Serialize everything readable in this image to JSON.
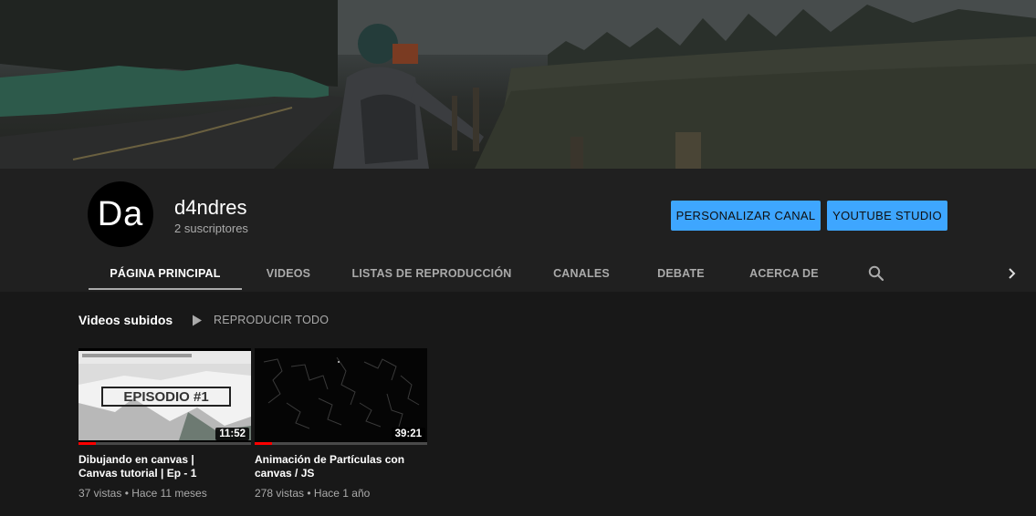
{
  "banner": {
    "sign_text": "",
    "description": ""
  },
  "channel": {
    "avatar_text": "Da",
    "name": "d4ndres",
    "subscribers": "2 suscriptores"
  },
  "actions": {
    "customize_label": "PERSONALIZAR CANAL",
    "studio_label": "YOUTUBE STUDIO"
  },
  "tabs": [
    {
      "label": "PÁGINA PRINCIPAL",
      "active": true
    },
    {
      "label": "VIDEOS",
      "active": false
    },
    {
      "label": "LISTAS DE REPRODUCCIÓN",
      "active": false
    },
    {
      "label": "CANALES",
      "active": false
    },
    {
      "label": "DEBATE",
      "active": false
    },
    {
      "label": "ACERCA DE",
      "active": false
    }
  ],
  "icons": {
    "search": "search-icon",
    "next": "chevron-right-icon",
    "play": "play-icon"
  },
  "section": {
    "title": "Videos subidos",
    "play_all_label": "REPRODUCIR TODO"
  },
  "videos": [
    {
      "title_line1": "Dibujando en canvas |",
      "title_line2": "Canvas tutorial | Ep - 1",
      "duration": "11:52",
      "views": "37 vistas",
      "age": "Hace 11 meses",
      "thumb_text": "EPISODIO #1",
      "watched_fraction": 0.1
    },
    {
      "title_line1": "Animación de Partículas con",
      "title_line2": "canvas / JS",
      "duration": "39:21",
      "views": "278 vistas",
      "age": "Hace 1 año",
      "thumb_text": "",
      "watched_fraction": 0.1
    }
  ],
  "colors": {
    "accent": "#3ea6ff",
    "background": "#181818",
    "header": "#202020",
    "progress": "#ff0000"
  }
}
